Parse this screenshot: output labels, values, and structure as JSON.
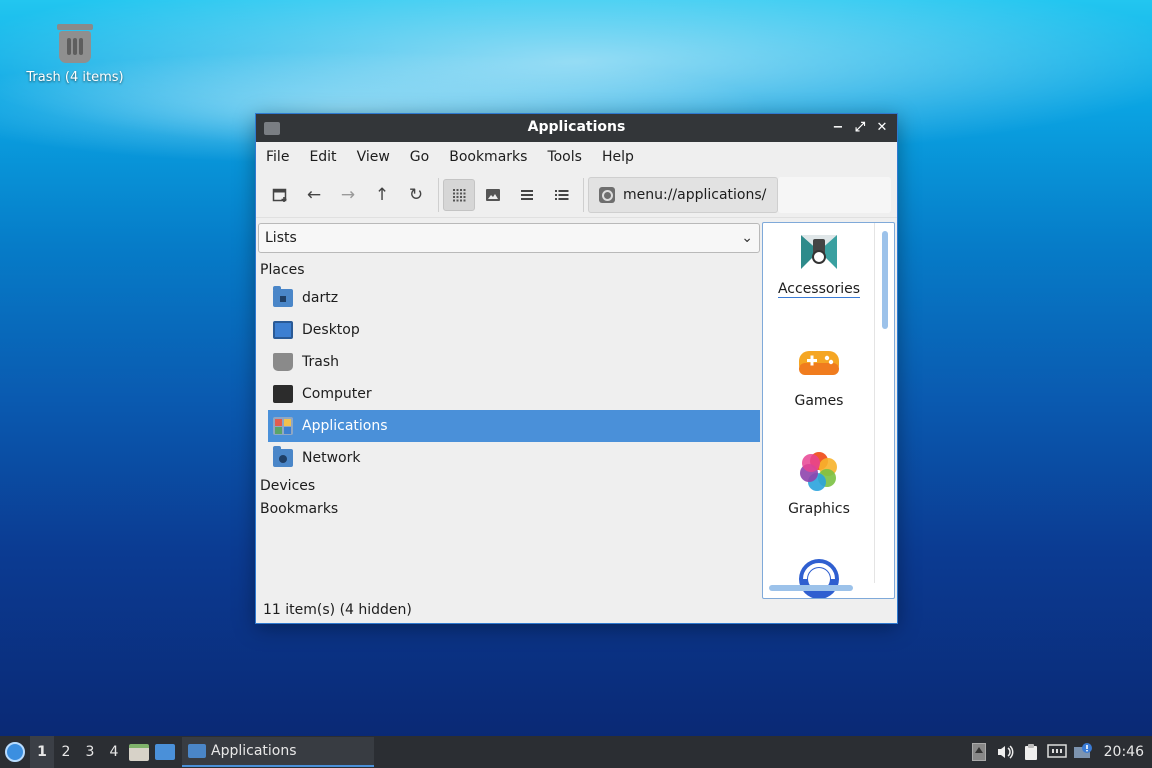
{
  "desktop": {
    "trash_label": "Trash (4 items)"
  },
  "window": {
    "title": "Applications",
    "controls": {
      "minimize": "−",
      "maximize": "⤢",
      "close": "✕"
    },
    "menu": [
      "File",
      "Edit",
      "View",
      "Go",
      "Bookmarks",
      "Tools",
      "Help"
    ],
    "toolbar": {
      "path": "menu://applications/",
      "view_modes": [
        "icon-view",
        "thumbnail-view",
        "compact-view",
        "detailed-list-view"
      ],
      "active_view": "icon-view"
    },
    "side_pane": {
      "selector_value": "Lists",
      "places_heading": "Places",
      "places": [
        {
          "label": "dartz",
          "icon": "home-folder-icon"
        },
        {
          "label": "Desktop",
          "icon": "desktop-icon"
        },
        {
          "label": "Trash",
          "icon": "trash-icon"
        },
        {
          "label": "Computer",
          "icon": "computer-icon"
        },
        {
          "label": "Applications",
          "icon": "applications-icon",
          "selected": true
        },
        {
          "label": "Network",
          "icon": "network-folder-icon"
        }
      ],
      "devices_heading": "Devices",
      "bookmarks_heading": "Bookmarks"
    },
    "folder_items": [
      {
        "label": "Accessories",
        "icon": "accessories-icon"
      },
      {
        "label": "Games",
        "icon": "games-icon"
      },
      {
        "label": "Graphics",
        "icon": "graphics-icon"
      },
      {
        "label": "",
        "icon": "internet-icon"
      }
    ],
    "status": "11 item(s) (4 hidden)"
  },
  "taskbar": {
    "workspaces": [
      "1",
      "2",
      "3",
      "4"
    ],
    "active_workspace": "1",
    "task_label": "Applications",
    "clock": "20:46"
  },
  "colors": {
    "selection": "#4a90d9",
    "titlebar": "#333639",
    "taskbar": "#2b2e33"
  }
}
